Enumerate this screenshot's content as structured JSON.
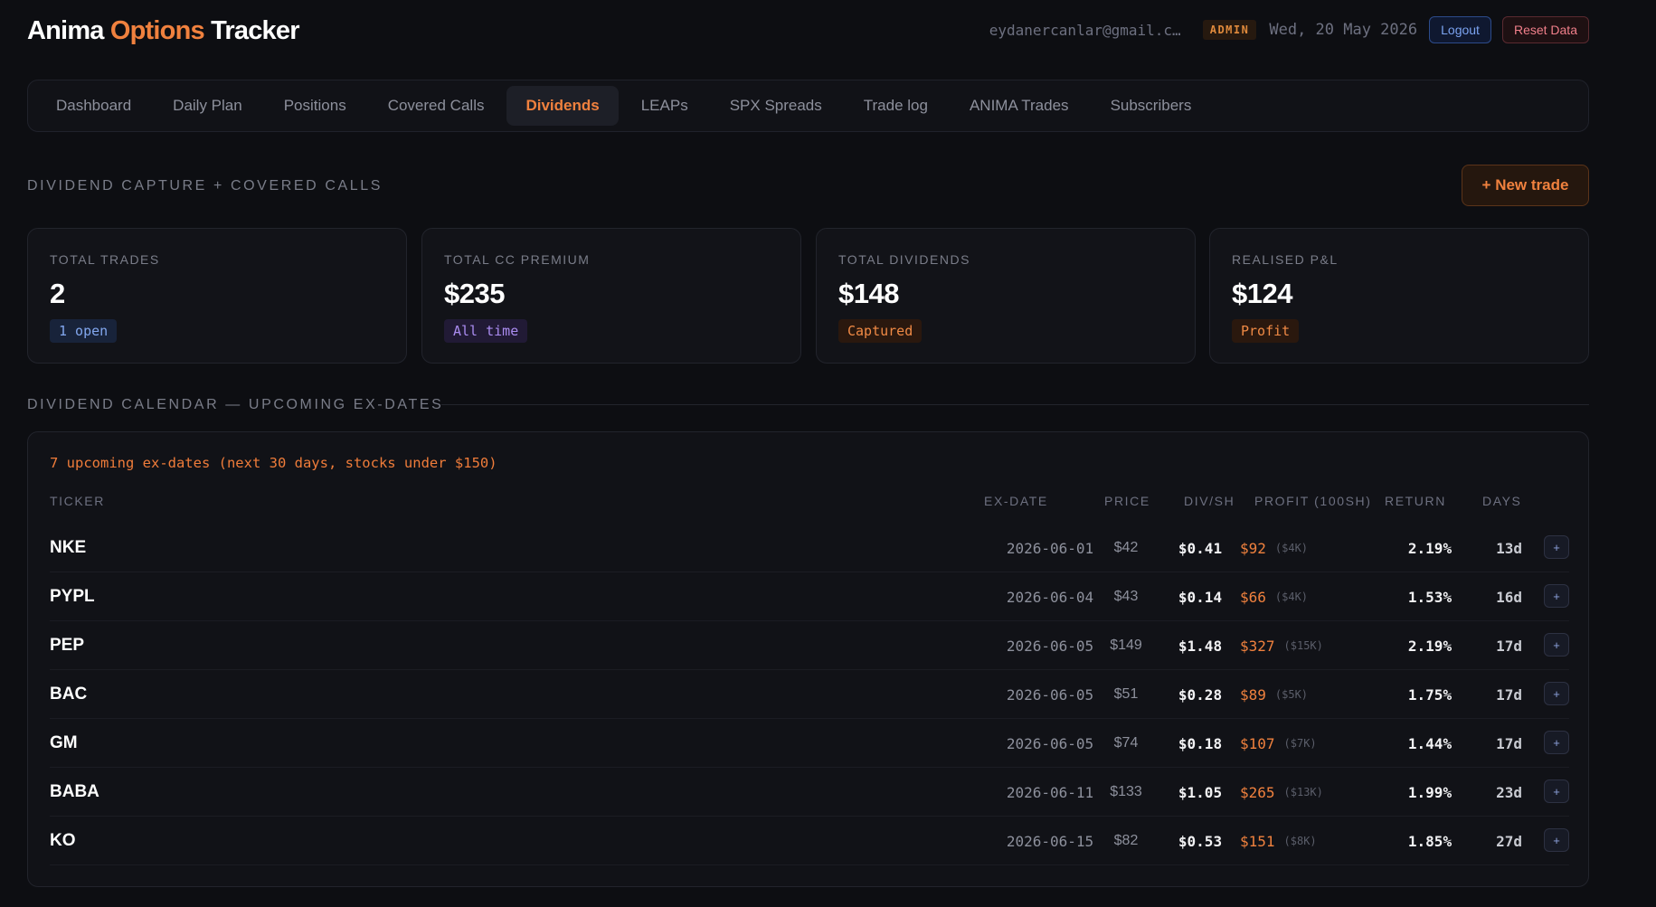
{
  "app": {
    "title_part1": "Anima ",
    "title_accent": "Options",
    "title_part2": " Tracker",
    "user_email": "eydanercanlar@gmail.com",
    "role_badge": "ADMIN",
    "date": "Wed, 20 May 2026",
    "logout_label": "Logout",
    "reset_label": "Reset Data"
  },
  "nav": {
    "tabs": [
      {
        "label": "Dashboard",
        "active": false
      },
      {
        "label": "Daily Plan",
        "active": false
      },
      {
        "label": "Positions",
        "active": false
      },
      {
        "label": "Covered Calls",
        "active": false
      },
      {
        "label": "Dividends",
        "active": true
      },
      {
        "label": "LEAPs",
        "active": false
      },
      {
        "label": "SPX Spreads",
        "active": false
      },
      {
        "label": "Trade log",
        "active": false
      },
      {
        "label": "ANIMA Trades",
        "active": false
      },
      {
        "label": "Subscribers",
        "active": false
      }
    ]
  },
  "section": {
    "title": "DIVIDEND CAPTURE + COVERED CALLS",
    "new_trade_label": "+ New trade"
  },
  "stats": [
    {
      "label": "TOTAL TRADES",
      "value": "2",
      "chip": "1 open",
      "chip_color": "blue"
    },
    {
      "label": "TOTAL CC PREMIUM",
      "value": "$235",
      "chip": "All time",
      "chip_color": "purple"
    },
    {
      "label": "TOTAL DIVIDENDS",
      "value": "$148",
      "chip": "Captured",
      "chip_color": "orange"
    },
    {
      "label": "REALISED P&L",
      "value": "$124",
      "chip": "Profit",
      "chip_color": "orange"
    }
  ],
  "calendar": {
    "title": "DIVIDEND CALENDAR — UPCOMING EX-DATES",
    "notice": "7 upcoming ex-dates (next 30 days, stocks under $150)",
    "columns": {
      "ticker": "TICKER",
      "exdate": "EX-DATE",
      "price": "PRICE",
      "divsh": "DIV/SH",
      "profit": "PROFIT (100SH)",
      "ret": "RETURN",
      "days": "DAYS"
    },
    "rows": [
      {
        "ticker": "NKE",
        "exdate": "2026-06-01",
        "price": "$42",
        "divsh": "$0.41",
        "profit": "$92",
        "profit_note": "($4K)",
        "ret": "2.19%",
        "days": "13d",
        "add": "+"
      },
      {
        "ticker": "PYPL",
        "exdate": "2026-06-04",
        "price": "$43",
        "divsh": "$0.14",
        "profit": "$66",
        "profit_note": "($4K)",
        "ret": "1.53%",
        "days": "16d",
        "add": "+"
      },
      {
        "ticker": "PEP",
        "exdate": "2026-06-05",
        "price": "$149",
        "divsh": "$1.48",
        "profit": "$327",
        "profit_note": "($15K)",
        "ret": "2.19%",
        "days": "17d",
        "add": "+"
      },
      {
        "ticker": "BAC",
        "exdate": "2026-06-05",
        "price": "$51",
        "divsh": "$0.28",
        "profit": "$89",
        "profit_note": "($5K)",
        "ret": "1.75%",
        "days": "17d",
        "add": "+"
      },
      {
        "ticker": "GM",
        "exdate": "2026-06-05",
        "price": "$74",
        "divsh": "$0.18",
        "profit": "$107",
        "profit_note": "($7K)",
        "ret": "1.44%",
        "days": "17d",
        "add": "+"
      },
      {
        "ticker": "BABA",
        "exdate": "2026-06-11",
        "price": "$133",
        "divsh": "$1.05",
        "profit": "$265",
        "profit_note": "($13K)",
        "ret": "1.99%",
        "days": "23d",
        "add": "+"
      },
      {
        "ticker": "KO",
        "exdate": "2026-06-15",
        "price": "$82",
        "divsh": "$0.53",
        "profit": "$151",
        "profit_note": "($8K)",
        "ret": "1.85%",
        "days": "27d",
        "add": "+"
      }
    ]
  }
}
